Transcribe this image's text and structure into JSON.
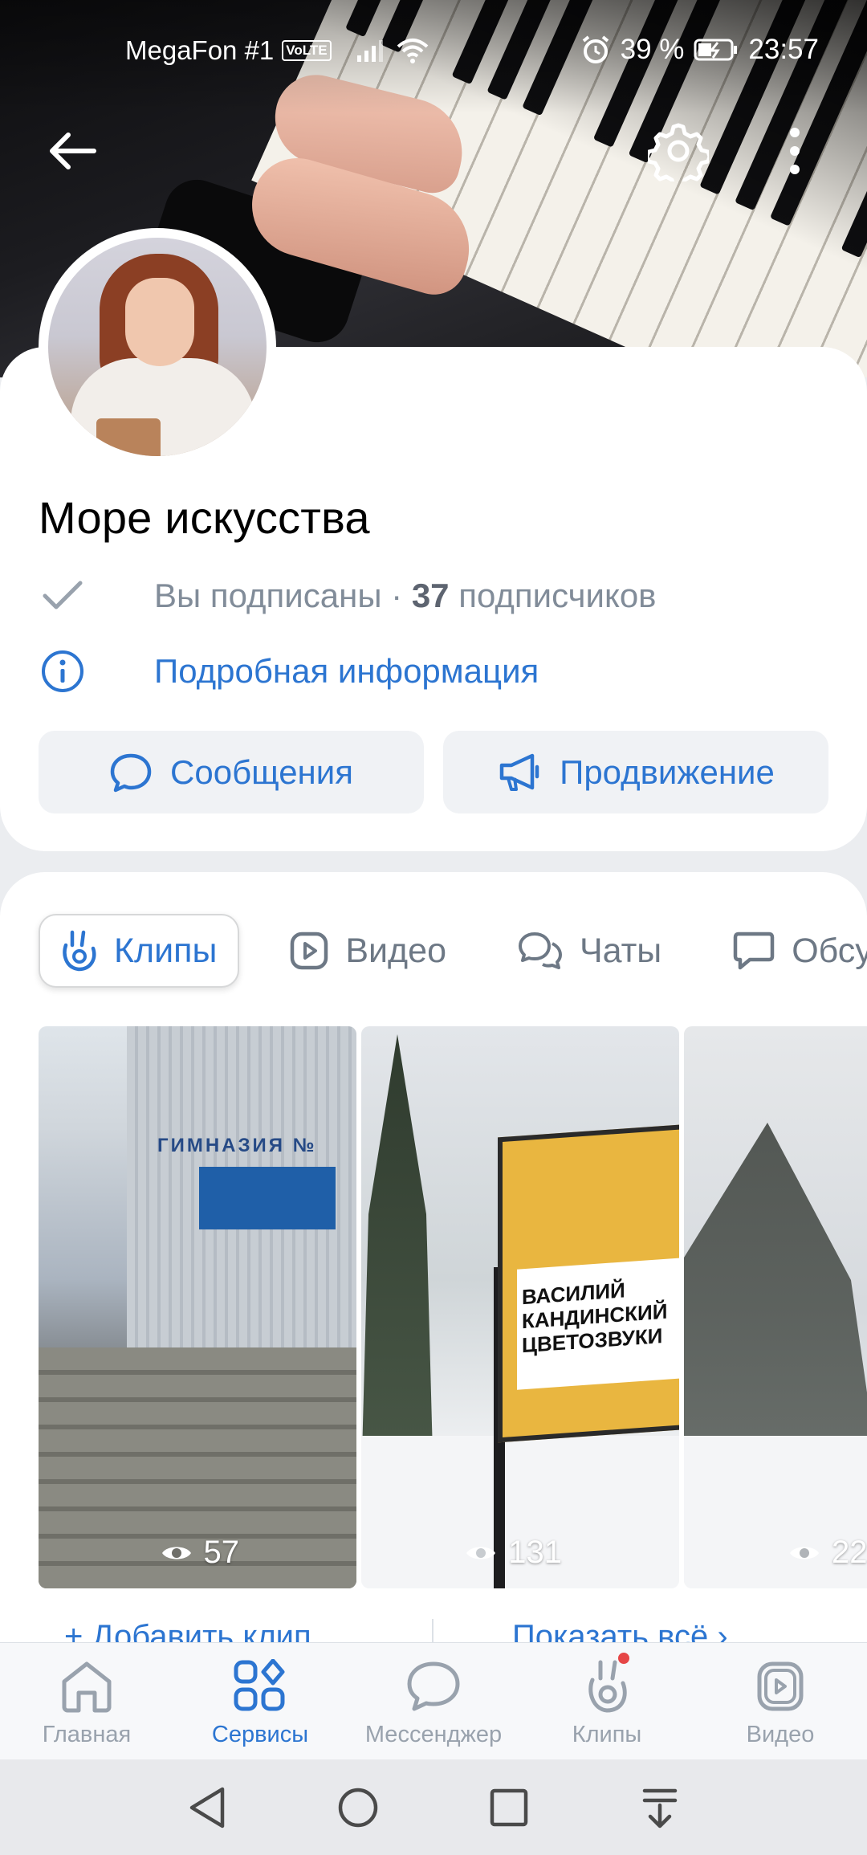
{
  "status_bar": {
    "carrier": "MegaFon #1",
    "volte": "VoLTE",
    "battery": "39 %",
    "time": "23:57"
  },
  "header": {
    "back_icon": "arrow-left-icon",
    "settings_icon": "gear-icon",
    "more_icon": "more-vertical-icon"
  },
  "profile": {
    "name": "Море искусства",
    "subscribed": "Вы подписаны ·",
    "subscribers_count": "37",
    "subscribers_label": "подписчиков",
    "info_link": "Подробная информация",
    "messages_button": "Сообщения",
    "promotion_button": "Продвижение"
  },
  "tabs": [
    {
      "label": "Клипы",
      "icon": "clips-icon",
      "active": true
    },
    {
      "label": "Видео",
      "icon": "play-icon",
      "active": false
    },
    {
      "label": "Чаты",
      "icon": "chats-icon",
      "active": false
    },
    {
      "label": "Обсу",
      "icon": "discussion-icon",
      "active": false
    }
  ],
  "clips": [
    {
      "views": "57"
    },
    {
      "views": "131"
    },
    {
      "views": "22"
    }
  ],
  "clip_scene_text": {
    "school": "ГИМНАЗИЯ №",
    "poster_title": "ВАСИЛИЙ КАНДИНСКИЙ ЦВЕТОЗВУКИ"
  },
  "clip_actions": {
    "add": "+ Добавить клип",
    "show_all": "Показать всё ›"
  },
  "tabbar": [
    {
      "label": "Главная",
      "icon": "home-icon",
      "active": false
    },
    {
      "label": "Сервисы",
      "icon": "services-icon",
      "active": true
    },
    {
      "label": "Мессенджер",
      "icon": "messenger-icon",
      "active": false
    },
    {
      "label": "Клипы",
      "icon": "clips-icon",
      "active": false,
      "badge": true
    },
    {
      "label": "Видео",
      "icon": "video-icon",
      "active": false
    }
  ],
  "colors": {
    "accent": "#2c75d1",
    "secondary_text": "#818c99",
    "background": "#ebedf0",
    "badge": "#e64646"
  }
}
